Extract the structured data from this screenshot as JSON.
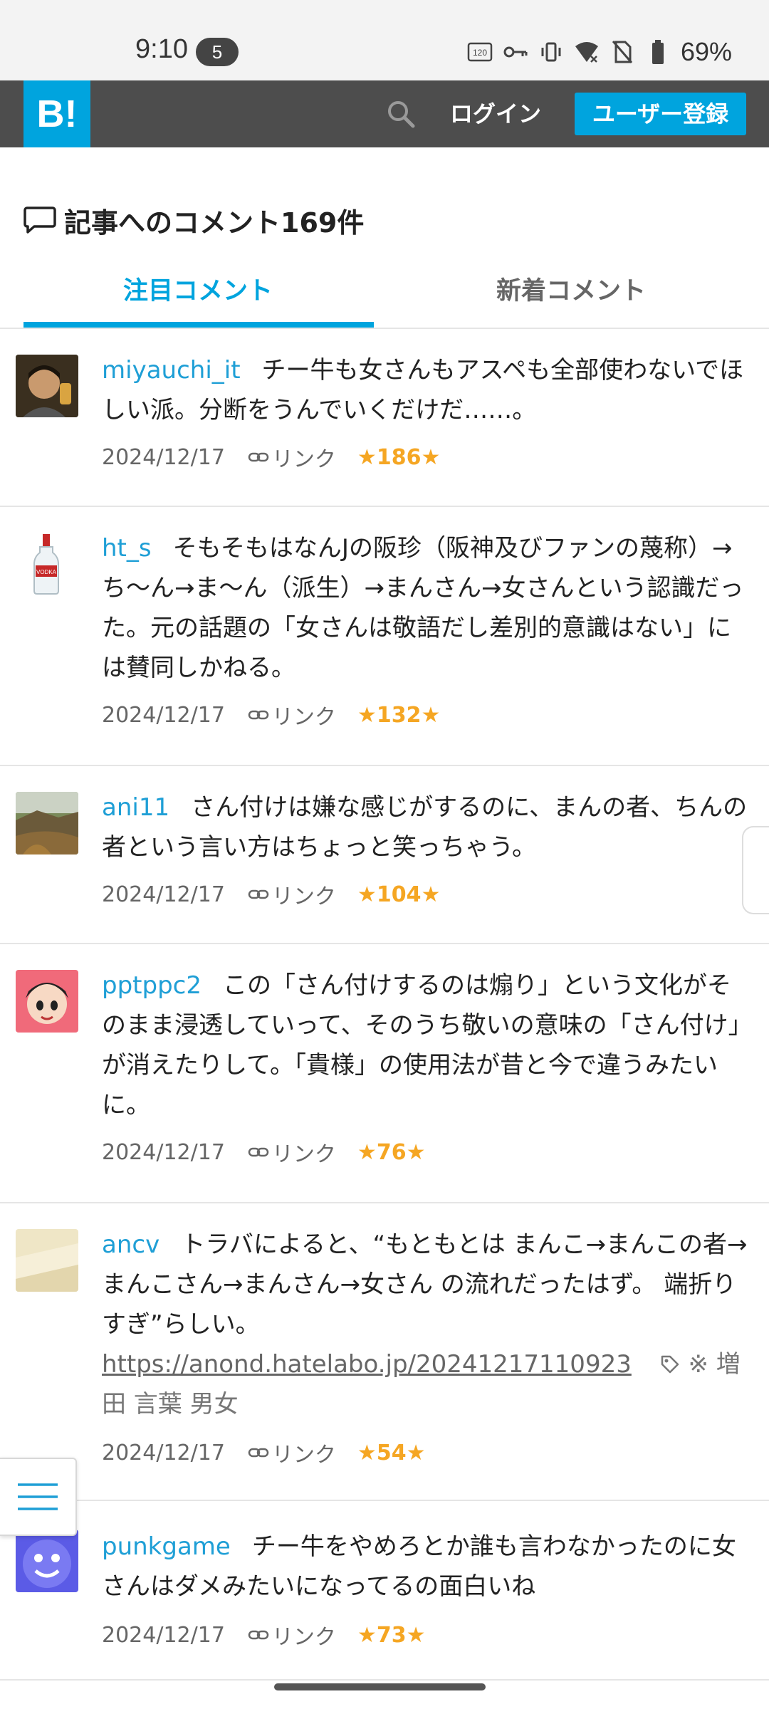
{
  "status_bar": {
    "time": "9:10",
    "notification_count": "5",
    "battery": "69%",
    "icons": [
      "120hz-icon",
      "key-icon",
      "vibrate-icon",
      "wifi-icon",
      "no-sim-icon",
      "battery-icon"
    ]
  },
  "header": {
    "logo": "B!",
    "login_label": "ログイン",
    "register_label": "ユーザー登録"
  },
  "section": {
    "title": "記事へのコメント169件"
  },
  "tabs": [
    {
      "label": "注目コメント",
      "active": true
    },
    {
      "label": "新着コメント",
      "active": false
    }
  ],
  "colors": {
    "accent": "#00a4de",
    "header_bg": "#4d4d4d",
    "star": "#f5a623",
    "username": "#1f9fd6"
  },
  "comments": [
    {
      "user": "miyauchi_it",
      "text": "チー牛も女さんもアスペも全部使わないでほしい派。分断をうんでいくだけだ……。",
      "date": "2024/12/17",
      "link_label": "リンク",
      "stars": "★186★"
    },
    {
      "user": "ht_s",
      "text": "そもそもはなんJの阪珍（阪神及びファンの蔑称）→ち〜ん→ま〜ん（派生）→まんさん→女さんという認識だった。元の話題の「女さんは敬語だし差別的意識はない」には賛同しかねる。",
      "date": "2024/12/17",
      "link_label": "リンク",
      "stars": "★132★"
    },
    {
      "user": "ani11",
      "text": "さん付けは嫌な感じがするのに、まんの者、ちんの者という言い方はちょっと笑っちゃう。",
      "date": "2024/12/17",
      "link_label": "リンク",
      "stars": "★104★"
    },
    {
      "user": "pptppc2",
      "text": "この「さん付けするのは煽り」という文化がそのまま浸透していって、そのうち敬いの意味の「さん付け」が消えたりして。「貴様」の使用法が昔と今で違うみたいに。",
      "date": "2024/12/17",
      "link_label": "リンク",
      "stars": "★76★"
    },
    {
      "user": "ancv",
      "text": "トラバによると、“もともとは まんこ→まんこの者→まんこさん→まんさん→女さん の流れだったはず。 端折りすぎ”らしい。",
      "url": "https://anond.hatelabo.jp/20241217110923",
      "tags": "※ 増田 言葉 男女",
      "date": "2024/12/17",
      "link_label": "リンク",
      "stars": "★54★"
    },
    {
      "user": "punkgame",
      "text": "チー牛をやめろとか誰も言わなかったのに女さんはダメみたいになってるの面白いね",
      "date": "2024/12/17",
      "link_label": "リンク",
      "stars": "★73★"
    }
  ]
}
